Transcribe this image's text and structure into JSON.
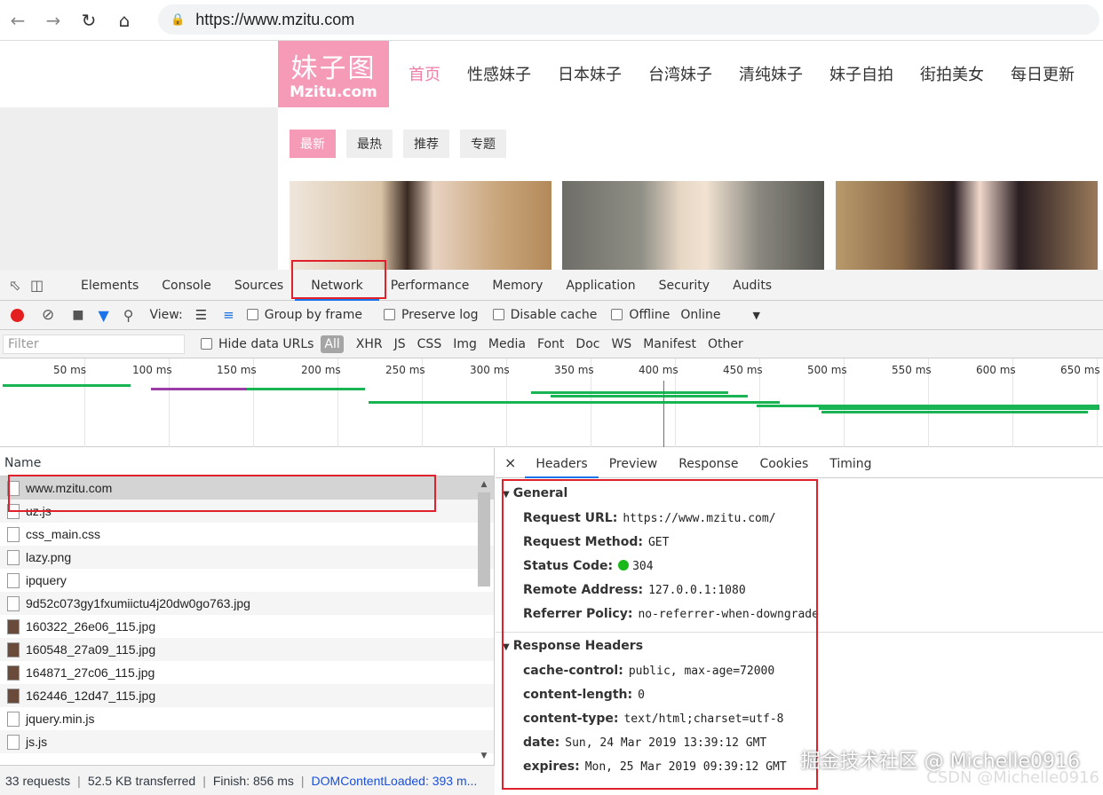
{
  "browser": {
    "url": "https://www.mzitu.com"
  },
  "site": {
    "logo_line1": "妹子图",
    "logo_line2": "Mzitu.com",
    "nav": [
      "首页",
      "性感妹子",
      "日本妹子",
      "台湾妹子",
      "清纯妹子",
      "妹子自拍",
      "街拍美女",
      "每日更新"
    ],
    "subtabs": [
      "最新",
      "最热",
      "推荐",
      "专题"
    ]
  },
  "devtools": {
    "tabs": [
      "Elements",
      "Console",
      "Sources",
      "Network",
      "Performance",
      "Memory",
      "Application",
      "Security",
      "Audits"
    ],
    "toolbar": {
      "view_label": "View:",
      "group_by_frame": "Group by frame",
      "preserve_log": "Preserve log",
      "disable_cache": "Disable cache",
      "offline": "Offline",
      "throttle": "Online"
    },
    "filter": {
      "placeholder": "Filter",
      "hide_data_urls": "Hide data URLs",
      "types": [
        "All",
        "XHR",
        "JS",
        "CSS",
        "Img",
        "Media",
        "Font",
        "Doc",
        "WS",
        "Manifest",
        "Other"
      ]
    },
    "timeline_ticks": [
      "50 ms",
      "100 ms",
      "150 ms",
      "200 ms",
      "250 ms",
      "300 ms",
      "350 ms",
      "400 ms",
      "450 ms",
      "500 ms",
      "550 ms",
      "600 ms",
      "650 ms"
    ],
    "name_header": "Name",
    "requests": [
      {
        "name": "www.mzitu.com",
        "kind": "doc"
      },
      {
        "name": "uz.js",
        "kind": "doc"
      },
      {
        "name": "css_main.css",
        "kind": "doc"
      },
      {
        "name": "lazy.png",
        "kind": "doc"
      },
      {
        "name": "ipquery",
        "kind": "doc"
      },
      {
        "name": "9d52c073gy1fxumiictu4j20dw0go763.jpg",
        "kind": "img"
      },
      {
        "name": "160322_26e06_115.jpg",
        "kind": "img"
      },
      {
        "name": "160548_27a09_115.jpg",
        "kind": "img"
      },
      {
        "name": "164871_27c06_115.jpg",
        "kind": "img"
      },
      {
        "name": "162446_12d47_115.jpg",
        "kind": "img"
      },
      {
        "name": "jquery.min.js",
        "kind": "doc"
      },
      {
        "name": "js.js",
        "kind": "doc"
      }
    ],
    "status": {
      "requests": "33 requests",
      "transferred": "52.5 KB transferred",
      "finish": "Finish: 856 ms",
      "dcl": "DOMContentLoaded: 393 m..."
    },
    "detail_tabs": [
      "Headers",
      "Preview",
      "Response",
      "Cookies",
      "Timing"
    ],
    "general_title": "General",
    "general": [
      {
        "key": "Request URL:",
        "value": "https://www.mzitu.com/"
      },
      {
        "key": "Request Method:",
        "value": "GET"
      },
      {
        "key": "Status Code:",
        "value": "304"
      },
      {
        "key": "Remote Address:",
        "value": "127.0.0.1:1080"
      },
      {
        "key": "Referrer Policy:",
        "value": "no-referrer-when-downgrade"
      }
    ],
    "response_title": "Response Headers",
    "response": [
      {
        "key": "cache-control:",
        "value": "public, max-age=72000"
      },
      {
        "key": "content-length:",
        "value": "0"
      },
      {
        "key": "content-type:",
        "value": "text/html;charset=utf-8"
      },
      {
        "key": "date:",
        "value": "Sun, 24 Mar 2019 13:39:12 GMT"
      },
      {
        "key": "expires:",
        "value": "Mon, 25 Mar 2019 09:39:12 GMT"
      }
    ]
  },
  "watermark": {
    "line1": "掘金技术社区 @ Michelle0916",
    "line2": "CSDN @Michelle0916"
  },
  "colors": {
    "accent_pink": "#f59bb8",
    "status_ok": "#1bb81b",
    "highlight_red": "#e0202a",
    "record_red": "#e41f1f"
  }
}
